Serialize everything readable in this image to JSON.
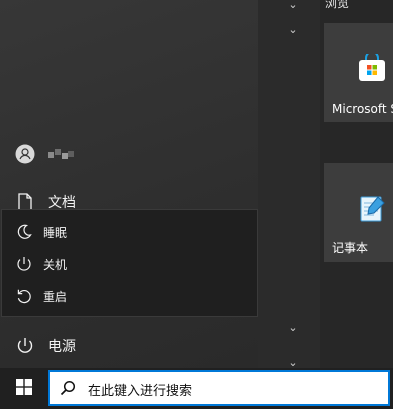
{
  "start_menu": {
    "user_name_obscured": "user-name-obscured",
    "documents_label": "文档",
    "power_label": "电源",
    "power_flyout": [
      {
        "label": "睡眠",
        "icon": "moon-icon"
      },
      {
        "label": "关机",
        "icon": "power-icon"
      },
      {
        "label": "重启",
        "icon": "restart-icon"
      }
    ],
    "tiles_header": "浏览",
    "tiles": [
      {
        "label": "Microsoft St",
        "icon": "store-icon"
      },
      {
        "label": "记事本",
        "icon": "notepad-icon"
      }
    ]
  },
  "taskbar": {
    "search_placeholder": "在此键入进行搜索",
    "start_icon": "windows-logo-icon",
    "search_icon": "search-icon"
  },
  "colors": {
    "accent": "#0078d7",
    "flyout_bg": "#1f1f1f",
    "tile_bg": "#3d3d3d"
  }
}
